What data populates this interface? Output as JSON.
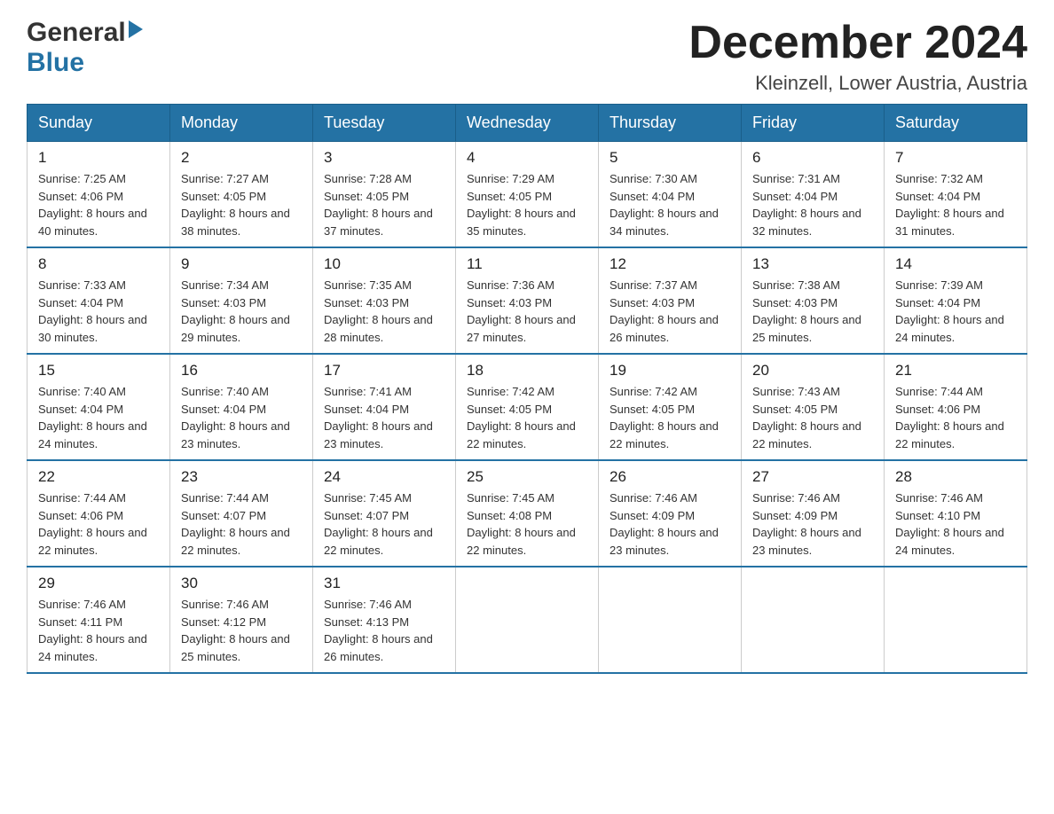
{
  "header": {
    "logo_general": "General",
    "logo_blue": "Blue",
    "month_title": "December 2024",
    "location": "Kleinzell, Lower Austria, Austria"
  },
  "weekdays": [
    "Sunday",
    "Monday",
    "Tuesday",
    "Wednesday",
    "Thursday",
    "Friday",
    "Saturday"
  ],
  "weeks": [
    [
      {
        "day": "1",
        "sunrise": "7:25 AM",
        "sunset": "4:06 PM",
        "daylight": "8 hours and 40 minutes."
      },
      {
        "day": "2",
        "sunrise": "7:27 AM",
        "sunset": "4:05 PM",
        "daylight": "8 hours and 38 minutes."
      },
      {
        "day": "3",
        "sunrise": "7:28 AM",
        "sunset": "4:05 PM",
        "daylight": "8 hours and 37 minutes."
      },
      {
        "day": "4",
        "sunrise": "7:29 AM",
        "sunset": "4:05 PM",
        "daylight": "8 hours and 35 minutes."
      },
      {
        "day": "5",
        "sunrise": "7:30 AM",
        "sunset": "4:04 PM",
        "daylight": "8 hours and 34 minutes."
      },
      {
        "day": "6",
        "sunrise": "7:31 AM",
        "sunset": "4:04 PM",
        "daylight": "8 hours and 32 minutes."
      },
      {
        "day": "7",
        "sunrise": "7:32 AM",
        "sunset": "4:04 PM",
        "daylight": "8 hours and 31 minutes."
      }
    ],
    [
      {
        "day": "8",
        "sunrise": "7:33 AM",
        "sunset": "4:04 PM",
        "daylight": "8 hours and 30 minutes."
      },
      {
        "day": "9",
        "sunrise": "7:34 AM",
        "sunset": "4:03 PM",
        "daylight": "8 hours and 29 minutes."
      },
      {
        "day": "10",
        "sunrise": "7:35 AM",
        "sunset": "4:03 PM",
        "daylight": "8 hours and 28 minutes."
      },
      {
        "day": "11",
        "sunrise": "7:36 AM",
        "sunset": "4:03 PM",
        "daylight": "8 hours and 27 minutes."
      },
      {
        "day": "12",
        "sunrise": "7:37 AM",
        "sunset": "4:03 PM",
        "daylight": "8 hours and 26 minutes."
      },
      {
        "day": "13",
        "sunrise": "7:38 AM",
        "sunset": "4:03 PM",
        "daylight": "8 hours and 25 minutes."
      },
      {
        "day": "14",
        "sunrise": "7:39 AM",
        "sunset": "4:04 PM",
        "daylight": "8 hours and 24 minutes."
      }
    ],
    [
      {
        "day": "15",
        "sunrise": "7:40 AM",
        "sunset": "4:04 PM",
        "daylight": "8 hours and 24 minutes."
      },
      {
        "day": "16",
        "sunrise": "7:40 AM",
        "sunset": "4:04 PM",
        "daylight": "8 hours and 23 minutes."
      },
      {
        "day": "17",
        "sunrise": "7:41 AM",
        "sunset": "4:04 PM",
        "daylight": "8 hours and 23 minutes."
      },
      {
        "day": "18",
        "sunrise": "7:42 AM",
        "sunset": "4:05 PM",
        "daylight": "8 hours and 22 minutes."
      },
      {
        "day": "19",
        "sunrise": "7:42 AM",
        "sunset": "4:05 PM",
        "daylight": "8 hours and 22 minutes."
      },
      {
        "day": "20",
        "sunrise": "7:43 AM",
        "sunset": "4:05 PM",
        "daylight": "8 hours and 22 minutes."
      },
      {
        "day": "21",
        "sunrise": "7:44 AM",
        "sunset": "4:06 PM",
        "daylight": "8 hours and 22 minutes."
      }
    ],
    [
      {
        "day": "22",
        "sunrise": "7:44 AM",
        "sunset": "4:06 PM",
        "daylight": "8 hours and 22 minutes."
      },
      {
        "day": "23",
        "sunrise": "7:44 AM",
        "sunset": "4:07 PM",
        "daylight": "8 hours and 22 minutes."
      },
      {
        "day": "24",
        "sunrise": "7:45 AM",
        "sunset": "4:07 PM",
        "daylight": "8 hours and 22 minutes."
      },
      {
        "day": "25",
        "sunrise": "7:45 AM",
        "sunset": "4:08 PM",
        "daylight": "8 hours and 22 minutes."
      },
      {
        "day": "26",
        "sunrise": "7:46 AM",
        "sunset": "4:09 PM",
        "daylight": "8 hours and 23 minutes."
      },
      {
        "day": "27",
        "sunrise": "7:46 AM",
        "sunset": "4:09 PM",
        "daylight": "8 hours and 23 minutes."
      },
      {
        "day": "28",
        "sunrise": "7:46 AM",
        "sunset": "4:10 PM",
        "daylight": "8 hours and 24 minutes."
      }
    ],
    [
      {
        "day": "29",
        "sunrise": "7:46 AM",
        "sunset": "4:11 PM",
        "daylight": "8 hours and 24 minutes."
      },
      {
        "day": "30",
        "sunrise": "7:46 AM",
        "sunset": "4:12 PM",
        "daylight": "8 hours and 25 minutes."
      },
      {
        "day": "31",
        "sunrise": "7:46 AM",
        "sunset": "4:13 PM",
        "daylight": "8 hours and 26 minutes."
      },
      null,
      null,
      null,
      null
    ]
  ],
  "labels": {
    "sunrise_prefix": "Sunrise: ",
    "sunset_prefix": "Sunset: ",
    "daylight_prefix": "Daylight: "
  }
}
